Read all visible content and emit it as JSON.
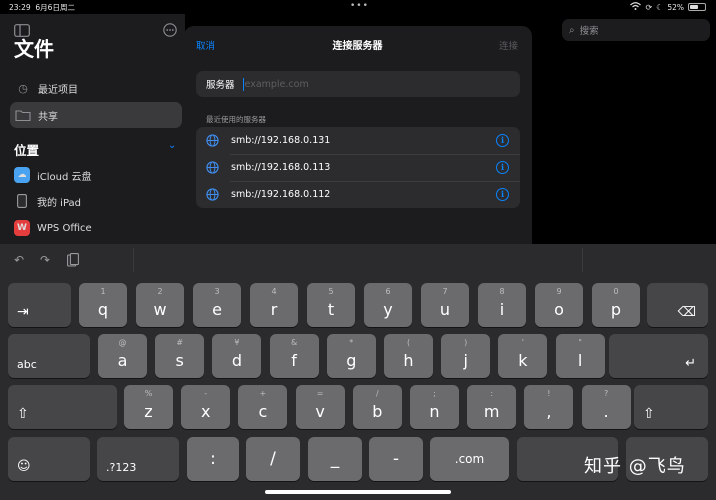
{
  "status": {
    "time": "23:29",
    "date": "6月6日周二",
    "battery": "52%"
  },
  "sidebar": {
    "title": "文件",
    "recent": "最近项目",
    "shared": "共享",
    "locations_label": "位置",
    "locations": [
      {
        "label": "iCloud 云盘",
        "icon": "cloud-icon",
        "color": "#4aa3f0"
      },
      {
        "label": "我的 iPad",
        "icon": "ipad-icon",
        "color": "#3a3a3c"
      },
      {
        "label": "WPS Office",
        "icon": "wps-icon",
        "color": "#e43d3d"
      }
    ]
  },
  "search": {
    "placeholder": "搜索"
  },
  "dialog": {
    "cancel": "取消",
    "title": "连接服务器",
    "connect": "连接",
    "field_label": "服务器",
    "field_placeholder": "example.com",
    "recent_header": "最近使用的服务器",
    "recent_servers": [
      "smb://192.168.0.131",
      "smb://192.168.0.113",
      "smb://192.168.0.112"
    ]
  },
  "keyboard": {
    "row1": [
      {
        "hint": "1",
        "key": "q"
      },
      {
        "hint": "2",
        "key": "w"
      },
      {
        "hint": "3",
        "key": "e"
      },
      {
        "hint": "4",
        "key": "r"
      },
      {
        "hint": "5",
        "key": "t"
      },
      {
        "hint": "6",
        "key": "y"
      },
      {
        "hint": "7",
        "key": "u"
      },
      {
        "hint": "8",
        "key": "i"
      },
      {
        "hint": "9",
        "key": "o"
      },
      {
        "hint": "0",
        "key": "p"
      }
    ],
    "row2": [
      {
        "hint": "@",
        "key": "a"
      },
      {
        "hint": "#",
        "key": "s"
      },
      {
        "hint": "¥",
        "key": "d"
      },
      {
        "hint": "&",
        "key": "f"
      },
      {
        "hint": "*",
        "key": "g"
      },
      {
        "hint": "(",
        "key": "h"
      },
      {
        "hint": ")",
        "key": "j"
      },
      {
        "hint": "'",
        "key": "k"
      },
      {
        "hint": "\"",
        "key": "l"
      }
    ],
    "row3": [
      {
        "hint": "%",
        "key": "z"
      },
      {
        "hint": "-",
        "key": "x"
      },
      {
        "hint": "+",
        "key": "c"
      },
      {
        "hint": "=",
        "key": "v"
      },
      {
        "hint": "/",
        "key": "b"
      },
      {
        "hint": ";",
        "key": "n"
      },
      {
        "hint": ":",
        "key": "m"
      },
      {
        "hint": "!",
        "key": ","
      },
      {
        "hint": "?",
        "key": "."
      }
    ],
    "abc": "abc",
    "numbers": ".?123",
    "colon": ":",
    "slash": "/",
    "underscore": "_",
    "dash": "-",
    "dotcom": ".com"
  },
  "watermark": "知乎 @飞鸟"
}
